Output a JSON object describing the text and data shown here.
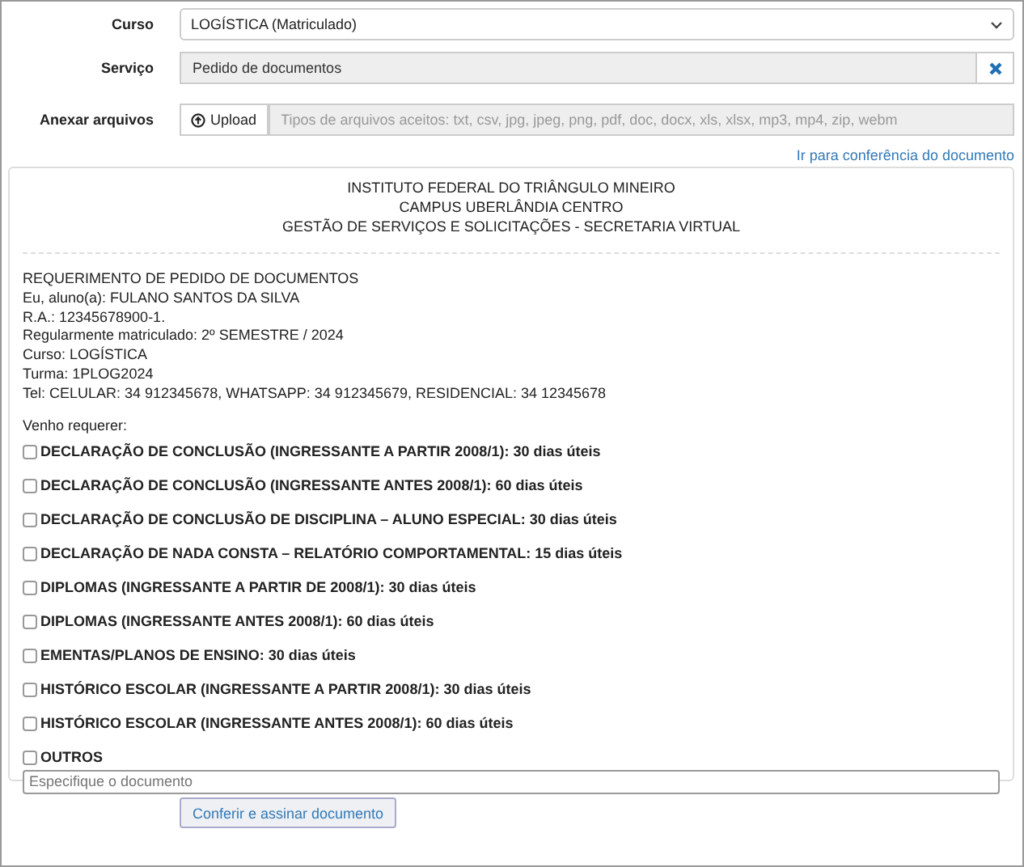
{
  "form": {
    "course": {
      "label": "Curso",
      "value": "LOGÍSTICA (Matriculado)"
    },
    "service": {
      "label": "Serviço",
      "value": "Pedido de documentos"
    },
    "attach": {
      "label": "Anexar arquivos",
      "button": "Upload",
      "placeholder": "Tipos de arquivos aceitos: txt, csv, jpg, jpeg, png, pdf, doc, docx, xls, xlsx, mp3, mp4, zip, webm"
    },
    "link": "Ir para conferência do documento"
  },
  "document": {
    "header": [
      "INSTITUTO FEDERAL DO TRIÂNGULO MINEIRO",
      "CAMPUS UBERLÂNDIA CENTRO",
      "GESTÃO DE SERVIÇOS E SOLICITAÇÕES - SECRETARIA VIRTUAL"
    ],
    "lines": [
      "REQUERIMENTO DE PEDIDO DE DOCUMENTOS",
      "Eu, aluno(a): FULANO SANTOS DA SILVA",
      "R.A.: 12345678900-1.",
      "Regularmente matriculado: 2º SEMESTRE / 2024",
      "Curso: LOGÍSTICA",
      "Turma: 1PLOG2024",
      "Tel: CELULAR: 34 912345678, WHATSAPP: 34 912345679, RESIDENCIAL: 34 12345678"
    ],
    "intro": "Venho requerer:",
    "options": [
      {
        "label": "DECLARAÇÃO DE CONCLUSÃO (INGRESSANTE A PARTIR 2008/1): 30 dias úteis",
        "checked": false
      },
      {
        "label": "DECLARAÇÃO DE CONCLUSÃO (INGRESSANTE ANTES 2008/1): 60 dias úteis",
        "checked": false
      },
      {
        "label": "DECLARAÇÃO DE CONCLUSÃO DE DISCIPLINA – ALUNO ESPECIAL: 30 dias úteis",
        "checked": false
      },
      {
        "label": "DECLARAÇÃO DE NADA CONSTA – RELATÓRIO COMPORTAMENTAL: 15 dias úteis",
        "checked": false
      },
      {
        "label": "DIPLOMAS (INGRESSANTE A PARTIR DE 2008/1): 30 dias úteis",
        "checked": false
      },
      {
        "label": "DIPLOMAS (INGRESSANTE ANTES 2008/1): 60 dias úteis",
        "checked": false
      },
      {
        "label": "EMENTAS/PLANOS DE ENSINO: 30 dias úteis",
        "checked": false
      },
      {
        "label": "HISTÓRICO ESCOLAR (INGRESSANTE A PARTIR 2008/1): 30 dias úteis",
        "checked": false
      },
      {
        "label": "HISTÓRICO ESCOLAR (INGRESSANTE ANTES 2008/1): 60 dias úteis",
        "checked": false
      },
      {
        "label": "OUTROS",
        "checked": false
      }
    ],
    "other_placeholder": "Especifique o documento"
  },
  "submit": "Conferir e assinar documento"
}
